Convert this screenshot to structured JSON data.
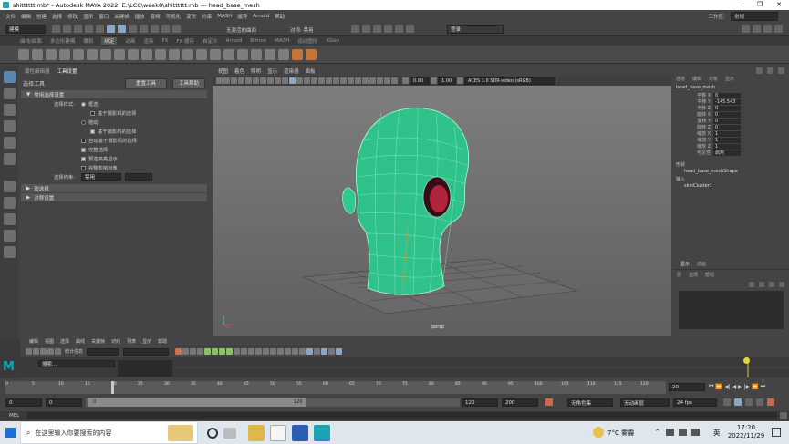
{
  "window": {
    "title": "shitttttt.mb* - Autodesk MAYA 2022: E:\\LCC\\week8\\shitttttt.mb  ---  head_base_mesh",
    "minimize": "—",
    "maximize": "❐",
    "close": "✕"
  },
  "menubar": {
    "items": [
      "文件",
      "编辑",
      "创建",
      "选择",
      "修改",
      "显示",
      "窗口",
      "关键帧",
      "播放",
      "音频",
      "可视化",
      "变形",
      "约束",
      "MASH",
      "缓存",
      "Arnold",
      "帮助"
    ],
    "workspace_label": "工作区:",
    "workspace_value": "常规"
  },
  "statusline": {
    "mode_value": "建模",
    "live_surface": "无激活的曲面",
    "symmetry": "对称: 禁用",
    "login": "登录"
  },
  "shelf": {
    "tabs": [
      "曲线/曲面",
      "多边形建模",
      "雕刻",
      "绑定",
      "动画",
      "渲染",
      "FX",
      "FX 缓存",
      "自定义",
      "Arnold",
      "Bifrost",
      "MASH",
      "运动图形",
      "XGen"
    ],
    "active_tab": "绑定"
  },
  "tool_settings": {
    "tabs": [
      "属性编辑器",
      "工具设置"
    ],
    "header": "选择工具",
    "reset_button": "重置工具",
    "help_button": "工具帮助",
    "common_section": "常用选择设置",
    "selection_style_label": "选择样式:",
    "options": {
      "marquee": "框选",
      "camera_based_1": "基于摄影机的选择",
      "drag": "拖动",
      "camera_based_2": "基于摄影机的选择",
      "auto_camera": "自动基于摄影机的选择",
      "soft_select": "完整选择",
      "preselect": "预选高亮显示",
      "affect_obj": "完整影响对象"
    },
    "constraint_label": "选择约束:",
    "constraint_value": "禁用",
    "collapsed_sections": [
      "软选择",
      "对称设置"
    ]
  },
  "viewport": {
    "menu": [
      "视图",
      "着色",
      "照明",
      "显示",
      "渲染器",
      "面板"
    ],
    "exposure": "0.00",
    "gamma": "1.00",
    "colorspace": "ACES 1.0 SDR-video (sRGB)",
    "camera_label": "persp"
  },
  "channel_box": {
    "menu": [
      "通道",
      "编辑",
      "对象",
      "显示"
    ],
    "object_name": "head_base_mesh",
    "attributes": [
      {
        "name": "平移 X",
        "value": "0"
      },
      {
        "name": "平移 Y",
        "value": "-145.543"
      },
      {
        "name": "平移 Z",
        "value": "0"
      },
      {
        "name": "旋转 X",
        "value": "0"
      },
      {
        "name": "旋转 Y",
        "value": "0"
      },
      {
        "name": "旋转 Z",
        "value": "0"
      },
      {
        "name": "缩放 X",
        "value": "1"
      },
      {
        "name": "缩放 Y",
        "value": "1"
      },
      {
        "name": "缩放 Z",
        "value": "1"
      },
      {
        "name": "可见性",
        "value": "启用"
      }
    ],
    "shapes_header": "形状",
    "shape_name": "head_base_meshShape",
    "inputs_header": "输入",
    "input_name": "skinCluster1"
  },
  "layers": {
    "tabs": [
      "显示",
      "动画"
    ],
    "menu": [
      "层",
      "选项",
      "帮助"
    ]
  },
  "graph_editor": {
    "menu": [
      "编辑",
      "视图",
      "选择",
      "曲线",
      "关键帧",
      "切线",
      "列表",
      "显示",
      "帮助"
    ],
    "stats_label": "统计信息",
    "search_placeholder": "搜索..."
  },
  "timeline": {
    "ticks": [
      "0",
      "5",
      "10",
      "15",
      "20",
      "25",
      "30",
      "35",
      "40",
      "45",
      "50",
      "55",
      "60",
      "65",
      "70",
      "75",
      "80",
      "85",
      "90",
      "95",
      "100",
      "105",
      "110",
      "115",
      "120"
    ],
    "current_frame": "20",
    "range_start": "0",
    "range_inner_start": "0",
    "range_slider_start": "0",
    "range_slider_end": "120",
    "range_inner_end": "120",
    "range_end": "200",
    "char_set": "无角色集",
    "anim_layer": "无动画层",
    "fps": "24 fps"
  },
  "command_line": {
    "label": "MEL"
  },
  "taskbar": {
    "search_placeholder": "在这里输入你要搜索的内容",
    "weather": "7°C 雾霾",
    "ime": "英",
    "time": "17:20",
    "date": "2022/11/29"
  }
}
